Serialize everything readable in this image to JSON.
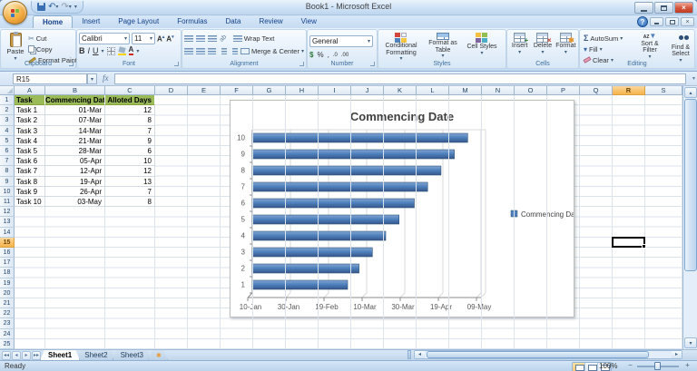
{
  "window": {
    "title": "Book1 - Microsoft Excel"
  },
  "ribbon": {
    "tabs": [
      {
        "label": "Home",
        "active": true
      },
      {
        "label": "Insert",
        "active": false
      },
      {
        "label": "Page Layout",
        "active": false
      },
      {
        "label": "Formulas",
        "active": false
      },
      {
        "label": "Data",
        "active": false
      },
      {
        "label": "Review",
        "active": false
      },
      {
        "label": "View",
        "active": false
      }
    ],
    "clipboard": {
      "label": "Clipboard",
      "paste": "Paste",
      "cut": "Cut",
      "copy": "Copy",
      "format_painter": "Format Painter"
    },
    "font": {
      "label": "Font",
      "font_name": "Calibri",
      "font_size": "11"
    },
    "alignment": {
      "label": "Alignment",
      "wrap_text": "Wrap Text",
      "merge_center": "Merge & Center"
    },
    "number": {
      "label": "Number",
      "format": "General"
    },
    "styles": {
      "label": "Styles",
      "conditional": "Conditional Formatting",
      "format_table": "Format as Table",
      "cell_styles": "Cell Styles"
    },
    "cells": {
      "label": "Cells",
      "insert": "Insert",
      "delete": "Delete",
      "format": "Format"
    },
    "editing": {
      "label": "Editing",
      "autosum": "AutoSum",
      "fill": "Fill",
      "clear": "Clear",
      "sort_filter": "Sort & Filter",
      "find_select": "Find & Select"
    }
  },
  "formula_bar": {
    "name_box": "R15",
    "formula": ""
  },
  "sheet": {
    "columns": [
      "A",
      "B",
      "C",
      "D",
      "E",
      "F",
      "G",
      "H",
      "I",
      "J",
      "K",
      "L",
      "M",
      "N",
      "O",
      "P",
      "Q",
      "R",
      "S"
    ],
    "visible_rows": 25,
    "selected_cell": {
      "column": "R",
      "row": 15
    },
    "table": {
      "headers": [
        "Task",
        "Commencing Date",
        "Alloted Days"
      ],
      "header_bg": "#9bbb59",
      "rows": [
        [
          "Task 1",
          "01-Mar",
          "12"
        ],
        [
          "Task 2",
          "07-Mar",
          "8"
        ],
        [
          "Task 3",
          "14-Mar",
          "7"
        ],
        [
          "Task 4",
          "21-Mar",
          "9"
        ],
        [
          "Task 5",
          "28-Mar",
          "6"
        ],
        [
          "Task 6",
          "05-Apr",
          "10"
        ],
        [
          "Task 7",
          "12-Apr",
          "12"
        ],
        [
          "Task 8",
          "19-Apr",
          "13"
        ],
        [
          "Task 9",
          "26-Apr",
          "7"
        ],
        [
          "Task 10",
          "03-May",
          "8"
        ]
      ]
    }
  },
  "chart_data": {
    "type": "bar",
    "orientation": "horizontal",
    "title": "Commencing Date",
    "categories": [
      "1",
      "2",
      "3",
      "4",
      "5",
      "6",
      "7",
      "8",
      "9",
      "10"
    ],
    "series": [
      {
        "name": "Commencing Date",
        "values": [
          "01-Mar",
          "07-Mar",
          "14-Mar",
          "21-Mar",
          "28-Mar",
          "05-Apr",
          "12-Apr",
          "19-Apr",
          "26-Apr",
          "03-May"
        ],
        "day_offsets_from_axis_start": [
          50,
          56,
          63,
          70,
          77,
          85,
          92,
          99,
          106,
          113
        ]
      }
    ],
    "x_axis": {
      "tick_labels": [
        "10-Jan",
        "30-Jan",
        "19-Feb",
        "10-Mar",
        "30-Mar",
        "19-Apr",
        "09-May"
      ],
      "tick_interval_days": 20,
      "min": "10-Jan",
      "max": "09-May"
    },
    "legend": {
      "position": "right",
      "label": "Commencing Date"
    },
    "bar_color": "#4f81bd",
    "gridlines": true,
    "style": "3d-bevel"
  },
  "sheet_tabs": {
    "tabs": [
      "Sheet1",
      "Sheet2",
      "Sheet3"
    ],
    "active_index": 0
  },
  "status_bar": {
    "status": "Ready",
    "zoom_level": "100%"
  },
  "icons": {
    "dropdown": "▾",
    "undo": "↶",
    "redo": "↷",
    "scissors": "✂",
    "sigma": "Σ",
    "fx": "fx",
    "help": "?",
    "close": "×",
    "bold": "B",
    "italic": "I",
    "underline": "U",
    "grow_font": "A",
    "shrink_font": "A",
    "up_small": "▴",
    "down_small": "▾",
    "left_small": "◂",
    "right_small": "▸",
    "currency": "$",
    "percent": "%",
    "comma": ",",
    "increase_decimal": ".0",
    "decrease_decimal": ".00",
    "orientation": "ab",
    "fill_down": "▾",
    "funnel": "▼",
    "sort_az": "AZ",
    "merge_arrows": "↔",
    "minus": "−",
    "plus": "+",
    "insert_sheet_star": "✱",
    "nav_first": "◂◂",
    "nav_prev": "◂",
    "nav_next": "▸",
    "nav_last": "▸▸"
  }
}
